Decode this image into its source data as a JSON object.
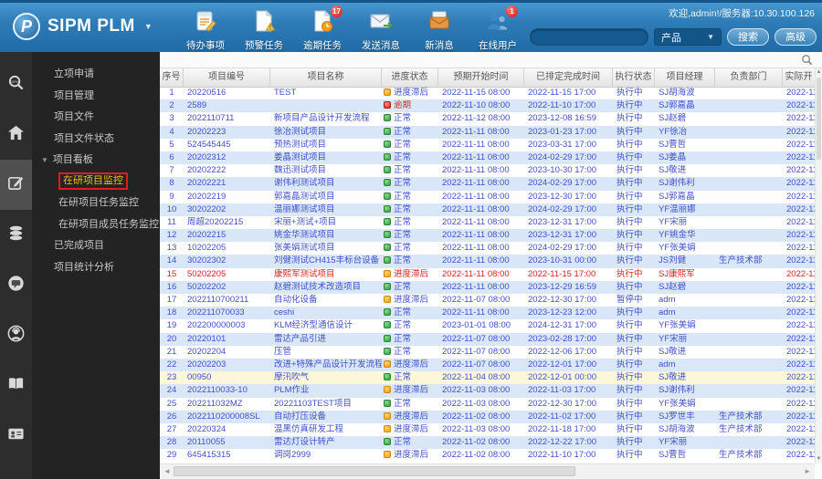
{
  "header": {
    "logo_letter": "P",
    "logo_text": "SIPM PLM",
    "welcome_text": "欢迎,admin!/服务器:10.30.100.126",
    "toolbar": [
      {
        "label": "待办事项",
        "icon": "todo-icon",
        "badge": ""
      },
      {
        "label": "预警任务",
        "icon": "warning-task-icon",
        "badge": ""
      },
      {
        "label": "逾期任务",
        "icon": "overdue-task-icon",
        "badge": "17"
      },
      {
        "label": "发送消息",
        "icon": "send-message-icon",
        "badge": ""
      },
      {
        "label": "新消息",
        "icon": "new-message-icon",
        "badge": ""
      },
      {
        "label": "在线用户",
        "icon": "online-users-icon",
        "badge": "1"
      }
    ],
    "search": {
      "value": "",
      "category": "产品",
      "search_label": "搜索",
      "advanced_label": "高级"
    }
  },
  "icons": {
    "caret_down": "▼",
    "scroll_up": "▲",
    "scroll_down": "▼",
    "scroll_left": "◄",
    "scroll_right": "►"
  },
  "sidebar": {
    "rail_icons": [
      "sipm-search-icon",
      "home-icon",
      "edit-icon",
      "database-icon",
      "chat-icon",
      "support-icon",
      "book-icon",
      "idcard-icon"
    ],
    "menu": [
      {
        "label": "立项申请",
        "type": "item"
      },
      {
        "label": "项目管理",
        "type": "item"
      },
      {
        "label": "项目文件",
        "type": "item"
      },
      {
        "label": "项目文件状态",
        "type": "item"
      },
      {
        "label": "项目看板",
        "type": "group",
        "expanded": true
      },
      {
        "label": "在研项目监控",
        "type": "subitem",
        "active": true
      },
      {
        "label": "在研项目任务监控",
        "type": "subitem"
      },
      {
        "label": "在研项目成员任务监控",
        "type": "subitem"
      },
      {
        "label": "已完成项目",
        "type": "item"
      },
      {
        "label": "项目统计分析",
        "type": "item"
      }
    ]
  },
  "table": {
    "columns": [
      "序号",
      "项目编号",
      "项目名称",
      "进度状态",
      "预期开始时间",
      "已排定完成时间",
      "执行状态",
      "项目经理",
      "负责部门",
      "实际开"
    ],
    "rows": [
      {
        "no": 1,
        "code": "20220516",
        "name": "TEST",
        "status": "进度滞后",
        "status_key": "lag",
        "start": "2022-11-15 08:00",
        "due": "2022-11-15 17:00",
        "exec": "执行中",
        "manager": "SJ胡海波",
        "dept": "",
        "actual": "2022-11-"
      },
      {
        "no": 2,
        "code": "2589",
        "name": "",
        "status": "逾期",
        "status_key": "overdue",
        "start": "2022-11-10 08:00",
        "due": "2022-11-10 17:00",
        "exec": "执行中",
        "manager": "SJ郭嘉晶",
        "dept": "",
        "actual": "2022-11-"
      },
      {
        "no": 3,
        "code": "2022110711",
        "name": "新项目产品设计开发流程",
        "status": "正常",
        "status_key": "ok",
        "start": "2022-11-12 08:00",
        "due": "2023-12-08 16:59",
        "exec": "执行中",
        "manager": "SJ赵碧",
        "dept": "",
        "actual": "2022-11-"
      },
      {
        "no": 4,
        "code": "20202223",
        "name": "徐冶测试项目",
        "status": "正常",
        "status_key": "ok",
        "start": "2022-11-11 08:00",
        "due": "2023-01-23 17:00",
        "exec": "执行中",
        "manager": "YF徐冶",
        "dept": "",
        "actual": "2022-11-"
      },
      {
        "no": 5,
        "code": "524545445",
        "name": "预热测试项目",
        "status": "正常",
        "status_key": "ok",
        "start": "2022-11-11 08:00",
        "due": "2023-03-31 17:00",
        "exec": "执行中",
        "manager": "SJ曹哲",
        "dept": "",
        "actual": "2022-11-"
      },
      {
        "no": 6,
        "code": "20202312",
        "name": "姜晶测试项目",
        "status": "正常",
        "status_key": "ok",
        "start": "2022-11-11 08:00",
        "due": "2024-02-29 17:00",
        "exec": "执行中",
        "manager": "SJ姜晶",
        "dept": "",
        "actual": "2022-11-"
      },
      {
        "no": 7,
        "code": "20202222",
        "name": "魏迅测试项目",
        "status": "正常",
        "status_key": "ok",
        "start": "2022-11-11 08:00",
        "due": "2023-10-30 17:00",
        "exec": "执行中",
        "manager": "SJ敬进",
        "dept": "",
        "actual": "2022-11-"
      },
      {
        "no": 8,
        "code": "20202221",
        "name": "谢伟利测试项目",
        "status": "正常",
        "status_key": "ok",
        "start": "2022-11-11 08:00",
        "due": "2024-02-29 17:00",
        "exec": "执行中",
        "manager": "SJ谢伟利",
        "dept": "",
        "actual": "2022-11-"
      },
      {
        "no": 9,
        "code": "20202219",
        "name": "郭嘉晶测试项目",
        "status": "正常",
        "status_key": "ok",
        "start": "2022-11-11 08:00",
        "due": "2023-12-30 17:00",
        "exec": "执行中",
        "manager": "SJ郭嘉晶",
        "dept": "",
        "actual": "2022-11-"
      },
      {
        "no": 10,
        "code": "30202202",
        "name": "温丽娜测试项目",
        "status": "正常",
        "status_key": "ok",
        "start": "2022-11-11 08:00",
        "due": "2024-02-29 17:00",
        "exec": "执行中",
        "manager": "YF温丽娜",
        "dept": "",
        "actual": "2022-11-"
      },
      {
        "no": 11,
        "code": "周超20202215",
        "name": "宋丽+测试+项目",
        "status": "正常",
        "status_key": "ok",
        "start": "2022-11-11 08:00",
        "due": "2023-12-31 17:00",
        "exec": "执行中",
        "manager": "YF宋丽",
        "dept": "",
        "actual": "2022-11-"
      },
      {
        "no": 12,
        "code": "20202215",
        "name": "姚金华测试项目",
        "status": "正常",
        "status_key": "ok",
        "start": "2022-11-11 08:00",
        "due": "2023-12-31 17:00",
        "exec": "执行中",
        "manager": "YF姚金华",
        "dept": "",
        "actual": "2022-11-"
      },
      {
        "no": 13,
        "code": "10202205",
        "name": "张美娟测试项目",
        "status": "正常",
        "status_key": "ok",
        "start": "2022-11-11 08:00",
        "due": "2024-02-29 17:00",
        "exec": "执行中",
        "manager": "YF张美娟",
        "dept": "",
        "actual": "2022-11-"
      },
      {
        "no": 14,
        "code": "30202302",
        "name": "刘健测试CH415丰标台设备",
        "status": "正常",
        "status_key": "ok",
        "start": "2022-11-11 08:00",
        "due": "2023-10-31 00:00",
        "exec": "执行中",
        "manager": "JS刘健",
        "dept": "生产技术部",
        "actual": "2022-11-"
      },
      {
        "no": 15,
        "code": "50202205",
        "name": "康熙军测试项目",
        "status": "进度滞后",
        "status_key": "lag",
        "start": "2022-11-11 08:00",
        "due": "2022-11-15 17:00",
        "exec": "执行中",
        "manager": "SJ康熙军",
        "dept": "",
        "actual": "2022-11-",
        "alert": true
      },
      {
        "no": 16,
        "code": "50202202",
        "name": "赵碧测试技术改造项目",
        "status": "正常",
        "status_key": "ok",
        "start": "2022-11-11 08:00",
        "due": "2023-12-29 16:59",
        "exec": "执行中",
        "manager": "SJ赵碧",
        "dept": "",
        "actual": "2022-11-"
      },
      {
        "no": 17,
        "code": "2022110700211",
        "name": "自动化设备",
        "status": "进度滞后",
        "status_key": "lag",
        "start": "2022-11-07 08:00",
        "due": "2022-12-30 17:00",
        "exec": "暂停中",
        "manager": "adm",
        "dept": "",
        "actual": "2022-11-"
      },
      {
        "no": 18,
        "code": "202211070033",
        "name": "ceshi",
        "status": "正常",
        "status_key": "ok",
        "start": "2022-11-11 08:00",
        "due": "2023-12-23 12:00",
        "exec": "执行中",
        "manager": "adm",
        "dept": "",
        "actual": "2022-11-"
      },
      {
        "no": 19,
        "code": "202200000003",
        "name": "KLM经济型通信设计",
        "status": "正常",
        "status_key": "ok",
        "start": "2023-01-01 08:00",
        "due": "2024-12-31 17:00",
        "exec": "执行中",
        "manager": "YF张美娟",
        "dept": "",
        "actual": "2022-11-"
      },
      {
        "no": 20,
        "code": "20220101",
        "name": "雷达产品引进",
        "status": "正常",
        "status_key": "ok",
        "start": "2022-11-07 08:00",
        "due": "2023-02-28 17:00",
        "exec": "执行中",
        "manager": "YF宋丽",
        "dept": "",
        "actual": "2022-11-"
      },
      {
        "no": 21,
        "code": "20202204",
        "name": "压管",
        "status": "正常",
        "status_key": "ok",
        "start": "2022-11-07 08:00",
        "due": "2022-12-06 17:00",
        "exec": "执行中",
        "manager": "SJ敬进",
        "dept": "",
        "actual": "2022-11-"
      },
      {
        "no": 22,
        "code": "20202203",
        "name": "改进+特殊产品设计开发流程",
        "status": "进度滞后",
        "status_key": "lag",
        "start": "2022-11-07 08:00",
        "due": "2022-12-01 17:00",
        "exec": "执行中",
        "manager": "adm",
        "dept": "",
        "actual": "2022-11-"
      },
      {
        "no": 23,
        "code": "00950",
        "name": "摩汛吹气",
        "status": "正常",
        "status_key": "ok",
        "start": "2022-11-04 08:00",
        "due": "2022-12-01 00:00",
        "exec": "执行中",
        "manager": "SJ敬进",
        "dept": "",
        "actual": "2022-11-",
        "highlight": true
      },
      {
        "no": 24,
        "code": "2022110033-10",
        "name": "PLM作业",
        "status": "进度滞后",
        "status_key": "lag",
        "start": "2022-11-03 08:00",
        "due": "2022-11-03 17:00",
        "exec": "执行中",
        "manager": "SJ谢伟利",
        "dept": "",
        "actual": "2022-11-"
      },
      {
        "no": 25,
        "code": "202211032MZ",
        "name": "20221103TEST项目",
        "status": "正常",
        "status_key": "ok",
        "start": "2022-11-03 08:00",
        "due": "2022-12-30 17:00",
        "exec": "执行中",
        "manager": "YF张美娟",
        "dept": "",
        "actual": "2022-11-"
      },
      {
        "no": 26,
        "code": "2022110200008SL",
        "name": "自动打压设备",
        "status": "进度滞后",
        "status_key": "lag",
        "start": "2022-11-02 08:00",
        "due": "2022-11-02 17:00",
        "exec": "执行中",
        "manager": "SJ罗世丰",
        "dept": "生产技术部",
        "actual": "2022-11-"
      },
      {
        "no": 27,
        "code": "20220324",
        "name": "温黑仿真研发工程",
        "status": "进度滞后",
        "status_key": "lag",
        "start": "2022-11-03 08:00",
        "due": "2022-11-18 17:00",
        "exec": "执行中",
        "manager": "SJ胡海波",
        "dept": "生产技术部",
        "actual": "2022-11-"
      },
      {
        "no": 28,
        "code": "20110055",
        "name": "雷达灯设计转产",
        "status": "正常",
        "status_key": "ok",
        "start": "2022-11-02 08:00",
        "due": "2022-12-22 17:00",
        "exec": "执行中",
        "manager": "YF宋丽",
        "dept": "",
        "actual": "2022-11-"
      },
      {
        "no": 29,
        "code": "645415315",
        "name": "调岗2999",
        "status": "进度滞后",
        "status_key": "lag",
        "start": "2022-11-02 08:00",
        "due": "2022-11-10 17:00",
        "exec": "执行中",
        "manager": "SJ曹哲",
        "dept": "生产技术部",
        "actual": "2022-11-"
      }
    ]
  },
  "colors": {
    "header_blue": "#2e7cb7",
    "link_blue": "#4050cc",
    "row_alt": "#d9e7f8",
    "row_highlight": "#fcf7d9",
    "alert_red": "#e02020",
    "status_ok": "#3faf4b",
    "status_lag": "#f2a71f",
    "status_overdue": "#d9342b",
    "active_menu_text": "#f3c01c",
    "active_menu_border": "#e21c1c"
  }
}
